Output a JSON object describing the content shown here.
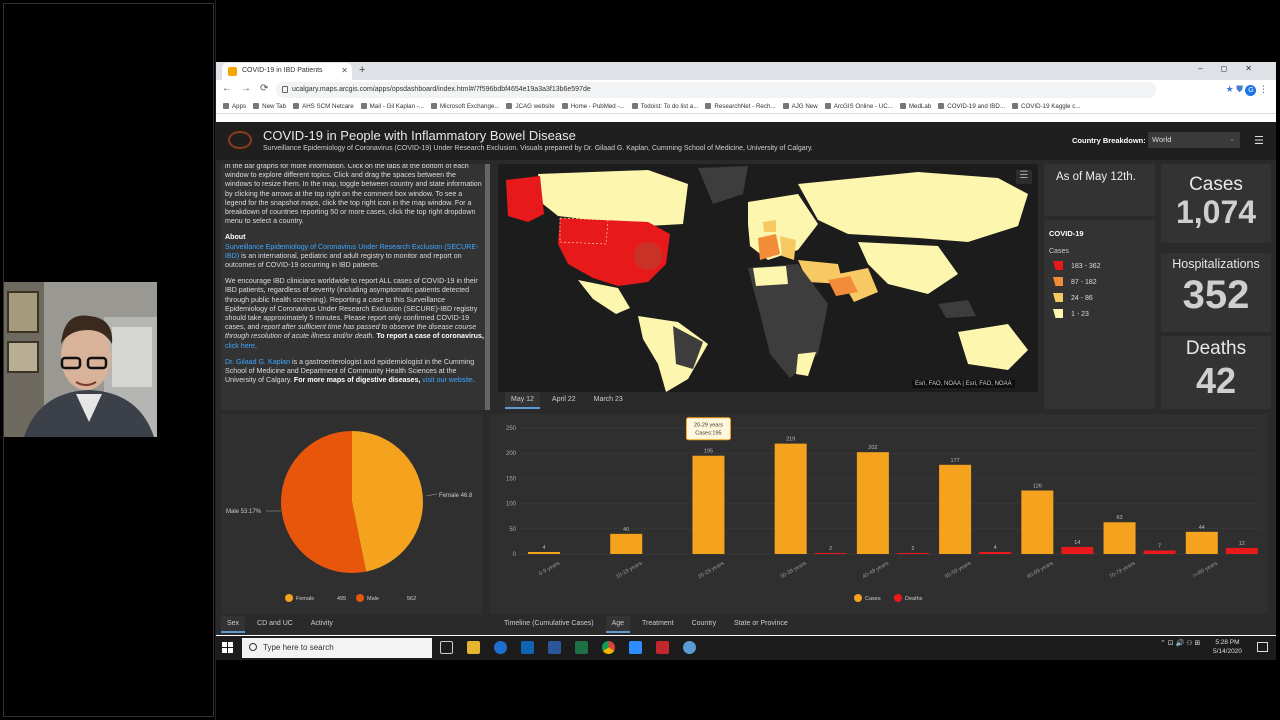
{
  "browser": {
    "tab_title": "COVID-19 in IBD Patients",
    "new_tab_symbol": "+",
    "url": "ucalgary.maps.arcgis.com/apps/opsdashboard/index.html#/7f596bdbf4654e19a3a3f13b6e597de",
    "bookmarks": [
      "Apps",
      "New Tab",
      "AHS SCM Netcare",
      "Mail - Gil Kaplan -...",
      "Microsoft Exchange...",
      "JCAG website",
      "Home - PubMed -...",
      "Todoist: To do list a...",
      "ResearchNet - Rech...",
      "AJG New",
      "ArcGIS Online - UC...",
      "MedLab",
      "COVID-19 and IBD...",
      "COVID-19 Kaggle c..."
    ]
  },
  "header": {
    "title": "COVID-19 in People with Inflammatory Bowel Disease",
    "subtitle": "Surveillance Epidemiology of Coronavirus (COVID-19) Under Research Exclusion. Visuals prepared by Dr. Gilaad G. Kaplan, Cumming School of Medicine, University of Calgary.",
    "country_label": "Country Breakdown:",
    "country_value": "World"
  },
  "info": {
    "intro": "in the bar graphs for more information. Click on the tabs at the bottom of each window to explore different topics. Click and drag the spaces between the windows to resize them. In the map, toggle between country and state information by clicking the arrows at the top right on the comment box window. To see a legend for the snapshot maps, click the top right icon in the map window. For a breakdown of countries reporting 50 or more cases, click the top right dropdown menu to select a country.",
    "about_head": "About",
    "secure_link": "Surveillance Epidemiology of Coronavirus Under Research Exclusion (SECURE-IBD)",
    "secure_text": " is an international, pediatric and adult registry to monitor and report on outcomes of COVID-19 occurring in IBD patients.",
    "encourage_text": "We encourage IBD clinicians worldwide to report ALL cases of COVID-19 in their IBD patients, regardless of severity (including asymptomatic patients detected through public health screening). Reporting a case to this Surveillance Epidemiology of Coronavirus Under Research Exclusion (SECURE)-IBD registry should take approximately 5 minutes. Please report only confirmed COVID-19 cases, and ",
    "encourage_italic": "report after sufficient time has passed to observe the disease course through resolution of acute illness and/or death.",
    "encourage_bold": " To report a case of coronavirus, ",
    "click_here": "click here",
    "kaplan_link": "Dr. Gilaad G. Kaplan",
    "kaplan_text": " is a gastroenterologist and epidemiologist in the Cumming School of Medicine and Department of Community Health Sciences at the University of Calgary.",
    "kaplan_bold": " For more maps of digestive diseases, ",
    "visit_link": "visit our website",
    "period": "."
  },
  "map": {
    "attribution": "Esri, FAO, NOAA | Esri, FAO, NOAA",
    "tabs": [
      "May 12",
      "April 22",
      "March 23"
    ]
  },
  "asof": "As of May 12th.",
  "legend": {
    "title": "COVID-19",
    "sub": "Cases",
    "items": [
      {
        "label": "183 - 362",
        "color": "#e8191b"
      },
      {
        "label": "87 - 182",
        "color": "#f28c38"
      },
      {
        "label": "24 - 86",
        "color": "#f6c963"
      },
      {
        "label": "1 - 23",
        "color": "#fdf6ae"
      }
    ]
  },
  "stats": {
    "cases_label": "Cases",
    "cases_value": "1,074",
    "hosp_label": "Hospitalizations",
    "hosp_value": "352",
    "deaths_label": "Deaths",
    "deaths_value": "42"
  },
  "pie": {
    "label_male": "Male  53.17%",
    "label_female": "Female  46.8",
    "legend_female": "Female",
    "female_value": "495",
    "legend_male": "Male",
    "male_value": "562",
    "tabs": [
      "Sex",
      "CD and UC",
      "Activity"
    ]
  },
  "bar_tabs": [
    "Timeline (Cumulative Cases)",
    "Age",
    "Treatment",
    "Country",
    "State or Province"
  ],
  "tooltip": {
    "line1": "20-29 years",
    "line2": "Cases:195"
  },
  "chart_data": [
    {
      "type": "pie",
      "categories": [
        "Female",
        "Male"
      ],
      "values": [
        495,
        562
      ],
      "colors": [
        "#f5a21f",
        "#e8560c"
      ],
      "legend": "bottom"
    },
    {
      "type": "bar",
      "categories": [
        "0-9 years",
        "10-19 years",
        "20-29 years",
        "30-39 years",
        "40-49 years",
        "50-59 years",
        "60-69 years",
        "70-79 years",
        ">=80 years"
      ],
      "series": [
        {
          "name": "Cases",
          "values": [
            4,
            40,
            195,
            219,
            202,
            177,
            126,
            63,
            44
          ],
          "color": "#f5a21f"
        },
        {
          "name": "Deaths",
          "values": [
            0,
            0,
            0,
            2,
            2,
            4,
            14,
            7,
            12
          ],
          "color": "#e8191b"
        }
      ],
      "yticks": [
        0,
        50,
        100,
        150,
        200,
        250
      ],
      "ylim": [
        0,
        250
      ],
      "legend": "bottom"
    }
  ],
  "taskbar": {
    "search_placeholder": "Type here to search",
    "time": "5:28 PM",
    "date": "5/14/2020"
  }
}
